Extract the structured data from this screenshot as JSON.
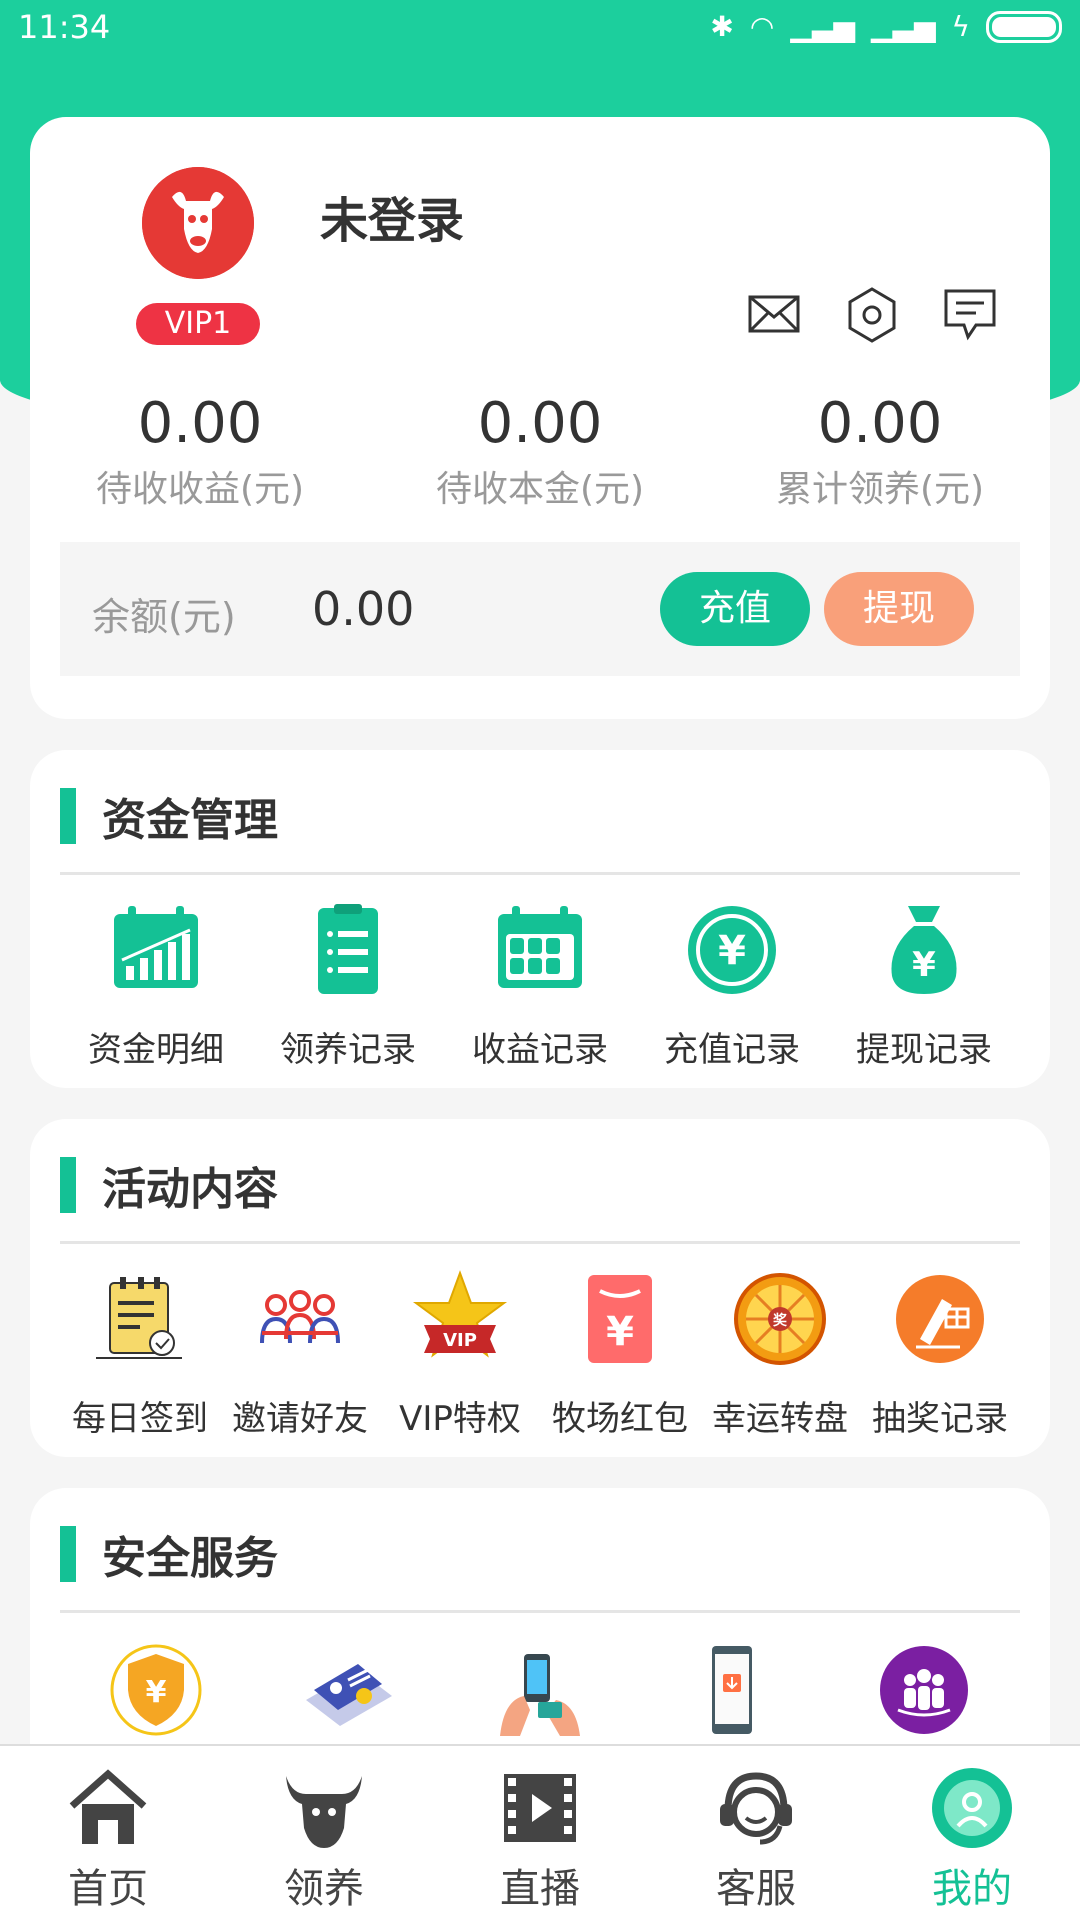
{
  "status_bar": {
    "time": "11:34"
  },
  "profile": {
    "username": "未登录",
    "vip_level": "VIP1",
    "stats": [
      {
        "value": "0.00",
        "label": "待收收益(元)"
      },
      {
        "value": "0.00",
        "label": "待收本金(元)"
      },
      {
        "value": "0.00",
        "label": "累计领养(元)"
      }
    ],
    "balance_label": "余额(元)",
    "balance_value": "0.00",
    "charge_label": "充值",
    "withdraw_label": "提现",
    "icons": [
      "mail-icon",
      "settings-icon",
      "message-icon"
    ]
  },
  "fund_management": {
    "title": "资金管理",
    "items": [
      {
        "label": "资金明细",
        "icon": "chart-calendar-icon"
      },
      {
        "label": "领养记录",
        "icon": "clipboard-list-icon"
      },
      {
        "label": "收益记录",
        "icon": "calendar-grid-icon"
      },
      {
        "label": "充值记录",
        "icon": "yuan-coin-icon"
      },
      {
        "label": "提现记录",
        "icon": "money-bag-icon"
      }
    ]
  },
  "activities": {
    "title": "活动内容",
    "items": [
      {
        "label": "每日签到",
        "icon": "checkin-notepad-icon"
      },
      {
        "label": "邀请好友",
        "icon": "invite-friends-icon"
      },
      {
        "label": "VIP特权",
        "icon": "vip-star-icon"
      },
      {
        "label": "牧场红包",
        "icon": "red-envelope-icon"
      },
      {
        "label": "幸运转盘",
        "icon": "lucky-wheel-icon"
      },
      {
        "label": "抽奖记录",
        "icon": "lottery-record-icon"
      }
    ]
  },
  "security": {
    "title": "安全服务",
    "items": [
      {
        "icon": "yuan-shield-icon"
      },
      {
        "icon": "id-card-icon"
      },
      {
        "icon": "phone-payment-icon"
      },
      {
        "icon": "phone-download-icon"
      },
      {
        "icon": "group-icon"
      }
    ]
  },
  "tabbar": [
    {
      "label": "首页",
      "icon": "home-icon",
      "active": false
    },
    {
      "label": "领养",
      "icon": "bull-icon",
      "active": false
    },
    {
      "label": "直播",
      "icon": "video-icon",
      "active": false
    },
    {
      "label": "客服",
      "icon": "customer-service-icon",
      "active": false
    },
    {
      "label": "我的",
      "icon": "profile-icon",
      "active": true
    }
  ],
  "colors": {
    "primary": "#1ccf9d",
    "accent_orange": "#f9a07a",
    "vip_red": "#ee3344"
  }
}
